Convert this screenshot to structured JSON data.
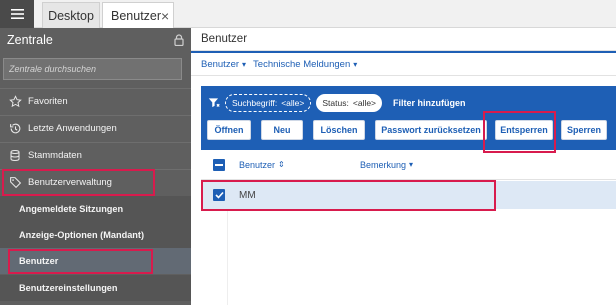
{
  "tabs": [
    {
      "label": "Desktop"
    },
    {
      "label": "Benutzer",
      "close": "×"
    }
  ],
  "sidebar": {
    "title": "Zentrale",
    "search_placeholder": "Zentrale durchsuchen",
    "items": [
      {
        "label": "Favoriten",
        "icon": "star-icon"
      },
      {
        "label": "Letzte Anwendungen",
        "icon": "history-icon"
      },
      {
        "label": "Stammdaten",
        "icon": "database-icon"
      },
      {
        "label": "Benutzerverwaltung",
        "icon": "tag-icon"
      }
    ],
    "subitems": [
      {
        "label": "Angemeldete Sitzungen"
      },
      {
        "label": "Anzeige-Optionen (Mandant)"
      },
      {
        "label": "Benutzer"
      },
      {
        "label": "Benutzereinstellungen"
      }
    ]
  },
  "main": {
    "title": "Benutzer",
    "crumbs": [
      {
        "label": "Benutzer",
        "chevron": "▾"
      },
      {
        "label": "Technische Meldungen",
        "chevron": "▾"
      }
    ],
    "filter": {
      "chip1_label": "Suchbegriff:",
      "chip1_value": "<alle>",
      "chip2_label": "Status:",
      "chip2_value": "<alle>",
      "add_label": "Filter hinzufügen"
    },
    "buttons": {
      "open": "Öffnen",
      "new": "Neu",
      "delete": "Löschen",
      "reset_password": "Passwort zurücksetzen",
      "unlock": "Entsperren",
      "lock": "Sperren"
    },
    "grid": {
      "columns": [
        "Benutzer",
        "Bemerkung"
      ],
      "col1_sort": "⇕",
      "col2_sort": "▾",
      "rows": [
        {
          "benutzer": "MM",
          "bemerkung": ""
        }
      ]
    }
  },
  "colors": {
    "accent": "#1e5fb5",
    "highlight": "#d81b4d",
    "sidebar": "#5f5f5f"
  }
}
